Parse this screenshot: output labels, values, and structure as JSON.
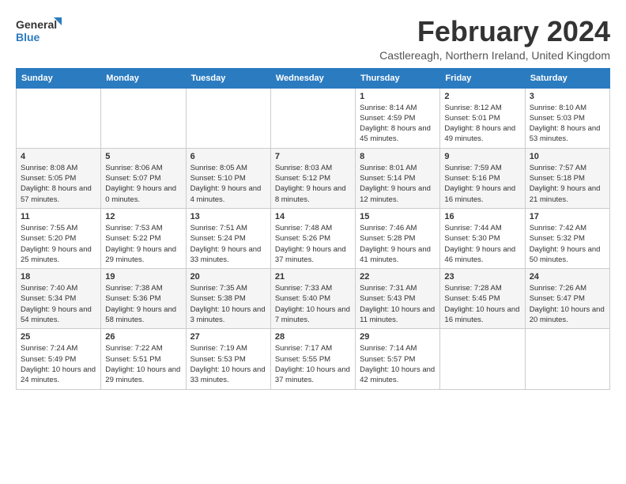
{
  "logo": {
    "line1": "General",
    "line2": "Blue"
  },
  "title": "February 2024",
  "location": "Castlereagh, Northern Ireland, United Kingdom",
  "days_of_week": [
    "Sunday",
    "Monday",
    "Tuesday",
    "Wednesday",
    "Thursday",
    "Friday",
    "Saturday"
  ],
  "weeks": [
    [
      {
        "day": "",
        "info": ""
      },
      {
        "day": "",
        "info": ""
      },
      {
        "day": "",
        "info": ""
      },
      {
        "day": "",
        "info": ""
      },
      {
        "day": "1",
        "info": "Sunrise: 8:14 AM\nSunset: 4:59 PM\nDaylight: 8 hours and 45 minutes."
      },
      {
        "day": "2",
        "info": "Sunrise: 8:12 AM\nSunset: 5:01 PM\nDaylight: 8 hours and 49 minutes."
      },
      {
        "day": "3",
        "info": "Sunrise: 8:10 AM\nSunset: 5:03 PM\nDaylight: 8 hours and 53 minutes."
      }
    ],
    [
      {
        "day": "4",
        "info": "Sunrise: 8:08 AM\nSunset: 5:05 PM\nDaylight: 8 hours and 57 minutes."
      },
      {
        "day": "5",
        "info": "Sunrise: 8:06 AM\nSunset: 5:07 PM\nDaylight: 9 hours and 0 minutes."
      },
      {
        "day": "6",
        "info": "Sunrise: 8:05 AM\nSunset: 5:10 PM\nDaylight: 9 hours and 4 minutes."
      },
      {
        "day": "7",
        "info": "Sunrise: 8:03 AM\nSunset: 5:12 PM\nDaylight: 9 hours and 8 minutes."
      },
      {
        "day": "8",
        "info": "Sunrise: 8:01 AM\nSunset: 5:14 PM\nDaylight: 9 hours and 12 minutes."
      },
      {
        "day": "9",
        "info": "Sunrise: 7:59 AM\nSunset: 5:16 PM\nDaylight: 9 hours and 16 minutes."
      },
      {
        "day": "10",
        "info": "Sunrise: 7:57 AM\nSunset: 5:18 PM\nDaylight: 9 hours and 21 minutes."
      }
    ],
    [
      {
        "day": "11",
        "info": "Sunrise: 7:55 AM\nSunset: 5:20 PM\nDaylight: 9 hours and 25 minutes."
      },
      {
        "day": "12",
        "info": "Sunrise: 7:53 AM\nSunset: 5:22 PM\nDaylight: 9 hours and 29 minutes."
      },
      {
        "day": "13",
        "info": "Sunrise: 7:51 AM\nSunset: 5:24 PM\nDaylight: 9 hours and 33 minutes."
      },
      {
        "day": "14",
        "info": "Sunrise: 7:48 AM\nSunset: 5:26 PM\nDaylight: 9 hours and 37 minutes."
      },
      {
        "day": "15",
        "info": "Sunrise: 7:46 AM\nSunset: 5:28 PM\nDaylight: 9 hours and 41 minutes."
      },
      {
        "day": "16",
        "info": "Sunrise: 7:44 AM\nSunset: 5:30 PM\nDaylight: 9 hours and 46 minutes."
      },
      {
        "day": "17",
        "info": "Sunrise: 7:42 AM\nSunset: 5:32 PM\nDaylight: 9 hours and 50 minutes."
      }
    ],
    [
      {
        "day": "18",
        "info": "Sunrise: 7:40 AM\nSunset: 5:34 PM\nDaylight: 9 hours and 54 minutes."
      },
      {
        "day": "19",
        "info": "Sunrise: 7:38 AM\nSunset: 5:36 PM\nDaylight: 9 hours and 58 minutes."
      },
      {
        "day": "20",
        "info": "Sunrise: 7:35 AM\nSunset: 5:38 PM\nDaylight: 10 hours and 3 minutes."
      },
      {
        "day": "21",
        "info": "Sunrise: 7:33 AM\nSunset: 5:40 PM\nDaylight: 10 hours and 7 minutes."
      },
      {
        "day": "22",
        "info": "Sunrise: 7:31 AM\nSunset: 5:43 PM\nDaylight: 10 hours and 11 minutes."
      },
      {
        "day": "23",
        "info": "Sunrise: 7:28 AM\nSunset: 5:45 PM\nDaylight: 10 hours and 16 minutes."
      },
      {
        "day": "24",
        "info": "Sunrise: 7:26 AM\nSunset: 5:47 PM\nDaylight: 10 hours and 20 minutes."
      }
    ],
    [
      {
        "day": "25",
        "info": "Sunrise: 7:24 AM\nSunset: 5:49 PM\nDaylight: 10 hours and 24 minutes."
      },
      {
        "day": "26",
        "info": "Sunrise: 7:22 AM\nSunset: 5:51 PM\nDaylight: 10 hours and 29 minutes."
      },
      {
        "day": "27",
        "info": "Sunrise: 7:19 AM\nSunset: 5:53 PM\nDaylight: 10 hours and 33 minutes."
      },
      {
        "day": "28",
        "info": "Sunrise: 7:17 AM\nSunset: 5:55 PM\nDaylight: 10 hours and 37 minutes."
      },
      {
        "day": "29",
        "info": "Sunrise: 7:14 AM\nSunset: 5:57 PM\nDaylight: 10 hours and 42 minutes."
      },
      {
        "day": "",
        "info": ""
      },
      {
        "day": "",
        "info": ""
      }
    ]
  ]
}
